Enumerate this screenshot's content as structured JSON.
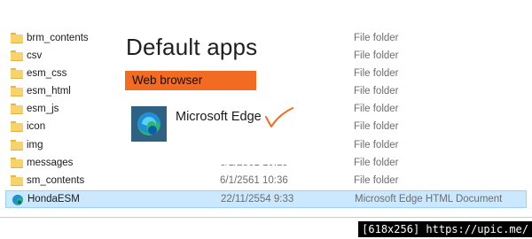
{
  "files": [
    {
      "name": "brm_contents",
      "date": "",
      "type": "File folder",
      "icon": "folder-icon"
    },
    {
      "name": "csv",
      "date": "",
      "type": "File folder",
      "icon": "folder-icon"
    },
    {
      "name": "esm_css",
      "date": "",
      "type": "File folder",
      "icon": "folder-icon"
    },
    {
      "name": "esm_html",
      "date": "",
      "type": "File folder",
      "icon": "folder-icon"
    },
    {
      "name": "esm_js",
      "date": "",
      "type": "File folder",
      "icon": "folder-icon"
    },
    {
      "name": "icon",
      "date": "",
      "type": "File folder",
      "icon": "folder-icon"
    },
    {
      "name": "img",
      "date": "",
      "type": "File folder",
      "icon": "folder-icon"
    },
    {
      "name": "messages",
      "date": "6/1/2561 10:15",
      "type": "File folder",
      "icon": "folder-icon"
    },
    {
      "name": "sm_contents",
      "date": "6/1/2561 10:36",
      "type": "File folder",
      "icon": "folder-icon"
    },
    {
      "name": "HondaESM",
      "date": "22/11/2554 9:33",
      "type": "Microsoft Edge HTML Document",
      "icon": "edge-icon",
      "selected": true
    }
  ],
  "overlay": {
    "title": "Default apps",
    "section_label": "Web browser",
    "app_name": "Microsoft Edge",
    "app_icon": "microsoft-edge-icon",
    "annotation": "check-mark-icon"
  },
  "watermark": {
    "text": "[618x256] https://upic.me/"
  },
  "colors": {
    "folder": "#f8d26a",
    "selected_row": "#cce8ff",
    "section_label_bg": "#f26b22",
    "check_mark": "#f26b22",
    "watermark_bg": "#000000"
  }
}
